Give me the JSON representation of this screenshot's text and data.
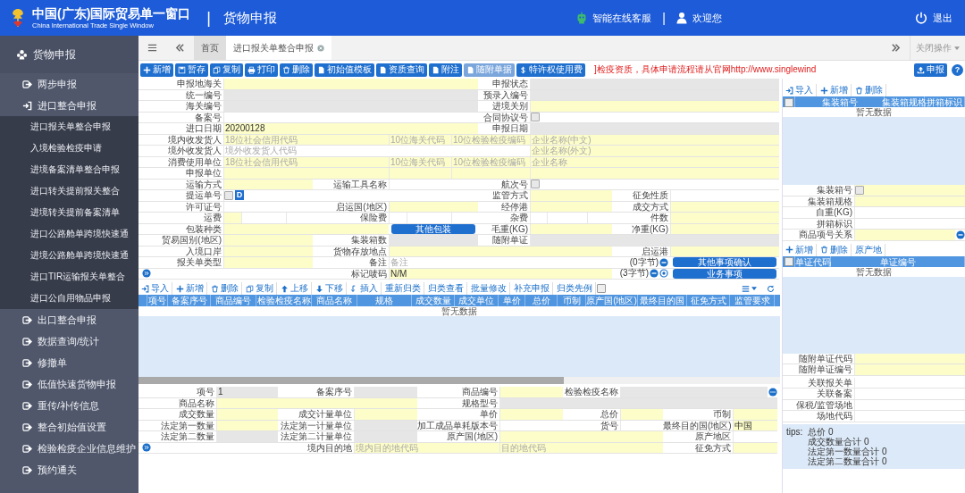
{
  "header": {
    "title": "中国(广东)国际贸易单一窗口",
    "subtitle": "China International Trade Single Window",
    "module": "货物申报",
    "service": "智能在线客服",
    "divider": "|",
    "welcome": "欢迎您",
    "logout": "退出"
  },
  "sidebar": {
    "title": "货物申报",
    "items": [
      {
        "label": "两步申报",
        "expanded": false
      },
      {
        "label": "进口整合申报",
        "expanded": true,
        "children": [
          {
            "label": "进口报关单整合申报"
          },
          {
            "label": "入境检验检疫申请"
          },
          {
            "label": "进境备案清单整合申报"
          },
          {
            "label": "进口转关提前报关整合"
          },
          {
            "label": "进境转关提前备案清单"
          },
          {
            "label": "进口公路舱单跨境快速通"
          },
          {
            "label": "进境公路舱单跨境快速通"
          },
          {
            "label": "进口TIR运输报关单整合"
          },
          {
            "label": "进口公自用物品申报"
          }
        ]
      },
      {
        "label": "出口整合申报",
        "expanded": false
      },
      {
        "label": "数据查询/统计",
        "expanded": false
      },
      {
        "label": "修撤单",
        "expanded": false
      },
      {
        "label": "低值快速货物申报",
        "expanded": false
      },
      {
        "label": "重传/补传信息",
        "expanded": false
      },
      {
        "label": "整合初始值设置",
        "expanded": false
      },
      {
        "label": "检验检疫企业信息维护",
        "expanded": false
      },
      {
        "label": "预约通关",
        "expanded": false
      }
    ]
  },
  "tabs": [
    {
      "label": "首页",
      "selected": false,
      "closable": false
    },
    {
      "label": "进口报关单整合申报",
      "selected": true,
      "closable": true
    }
  ],
  "tab_bar": {
    "close_ops": "关闭操作"
  },
  "toolbar": {
    "buttons": [
      {
        "label": "新增",
        "disabled": false
      },
      {
        "label": "暂存",
        "disabled": false
      },
      {
        "label": "复制",
        "disabled": false
      },
      {
        "label": "打印",
        "disabled": false
      },
      {
        "label": "删除",
        "disabled": false
      },
      {
        "label": "初始值模板",
        "disabled": false
      },
      {
        "label": "资质查询",
        "disabled": false
      },
      {
        "label": "附注",
        "disabled": false
      },
      {
        "label": "随附单据",
        "disabled": true
      },
      {
        "label": "特许权使用费",
        "disabled": false
      }
    ],
    "notice": "]检疫资质，具体申请流程请从官网http://www.singlewind",
    "submit": "申报",
    "help": "?"
  },
  "form": {
    "lines": [
      {
        "groups": [
          {
            "label": "申报地海关",
            "items": [
              {
                "kind": "field",
                "required": true
              }
            ]
          },
          {
            "label": "申报状态",
            "items": [
              {
                "kind": "field",
                "disabled": true
              }
            ]
          }
        ]
      },
      {
        "groups": [
          {
            "label": "统一编号",
            "items": [
              {
                "kind": "field",
                "disabled": true
              }
            ]
          },
          {
            "label": "预录入编号",
            "items": [
              {
                "kind": "field",
                "disabled": true
              }
            ]
          }
        ]
      },
      {
        "groups": [
          {
            "label": "海关编号",
            "items": [
              {
                "kind": "field",
                "disabled": true
              }
            ]
          },
          {
            "label": "进境关别",
            "items": [
              {
                "kind": "field",
                "required": true
              }
            ]
          }
        ]
      },
      {
        "groups": [
          {
            "label": "备案号",
            "items": [
              {
                "kind": "field",
                "required": false
              }
            ]
          },
          {
            "label": "合同协议号",
            "items": [
              {
                "kind": "field",
                "required": false,
                "checked": false
              }
            ]
          }
        ]
      },
      {
        "groups": [
          {
            "label": "进口日期",
            "items": [
              {
                "kind": "field",
                "required": true,
                "value": "20200128"
              }
            ]
          },
          {
            "label": "申报日期",
            "items": [
              {
                "kind": "field",
                "disabled": true
              }
            ]
          }
        ]
      },
      {
        "groups": [
          {
            "label": "境内收发货人",
            "items": [
              {
                "kind": "field",
                "required": true,
                "placeholder": "18位社会信用代码"
              },
              {
                "kind": "field",
                "required": true,
                "placeholder": "10位海关代码"
              },
              {
                "kind": "field",
                "required": true,
                "placeholder": "10位检验检疫编码"
              },
              {
                "kind": "field",
                "required": true,
                "placeholder": "企业名称(中文)"
              }
            ]
          }
        ]
      },
      {
        "groups": [
          {
            "label": "境外收发货人",
            "items": [
              {
                "kind": "field",
                "required": false,
                "placeholder": "境外收发货人代码"
              },
              {
                "kind": "field",
                "required": true,
                "placeholder": "企业名称(外文)"
              }
            ]
          }
        ]
      },
      {
        "groups": [
          {
            "label": "消费使用单位",
            "items": [
              {
                "kind": "field",
                "required": true,
                "placeholder": "18位社会信用代码"
              },
              {
                "kind": "field",
                "required": true,
                "placeholder": "10位海关代码"
              },
              {
                "kind": "field",
                "required": true,
                "placeholder": "10位检验检疫编码"
              },
              {
                "kind": "field",
                "required": true,
                "placeholder": "企业名称"
              }
            ]
          }
        ]
      },
      {
        "groups": [
          {
            "label": "申报单位",
            "items": [
              {
                "kind": "field",
                "required": true
              },
              {
                "kind": "field",
                "required": true
              },
              {
                "kind": "field",
                "required": true
              },
              {
                "kind": "field",
                "required": true
              }
            ]
          }
        ]
      },
      {
        "groups": [
          {
            "label": "运输方式",
            "items": [
              {
                "kind": "field",
                "required": true
              }
            ]
          },
          {
            "label": "运输工具名称",
            "items": [
              {
                "kind": "field",
                "required": false
              }
            ]
          },
          {
            "label": "航次号",
            "items": [
              {
                "kind": "field",
                "required": false,
                "checked": false
              }
            ]
          }
        ]
      },
      {
        "groups": [
          {
            "label": "提运单号",
            "items": [
              {
                "kind": "field",
                "required": false,
                "checked": false,
                "badge": "D"
              }
            ]
          },
          {
            "label": "监管方式",
            "items": [
              {
                "kind": "field",
                "required": true
              }
            ]
          },
          {
            "label": "征免性质",
            "items": [
              {
                "kind": "field",
                "required": false
              }
            ]
          }
        ]
      },
      {
        "groups": [
          {
            "label": "许可证号",
            "items": [
              {
                "kind": "field",
                "required": false
              }
            ]
          },
          {
            "label": "启运国(地区)",
            "items": [
              {
                "kind": "field",
                "required": true
              }
            ]
          },
          {
            "label": "经停港",
            "items": [
              {
                "kind": "field",
                "required": true
              }
            ]
          },
          {
            "label": "成交方式",
            "items": [
              {
                "kind": "field",
                "required": true
              }
            ]
          }
        ]
      },
      {
        "groups": [
          {
            "label": "运费",
            "items": [
              {
                "kind": "field",
                "required": true
              },
              {
                "kind": "field",
                "required": false
              },
              {
                "kind": "field",
                "required": false
              }
            ]
          },
          {
            "label": "保险费",
            "items": [
              {
                "kind": "field",
                "required": false
              },
              {
                "kind": "field",
                "required": false
              },
              {
                "kind": "field",
                "required": false
              }
            ]
          },
          {
            "label": "杂费",
            "items": [
              {
                "kind": "field",
                "required": false
              },
              {
                "kind": "field",
                "required": false
              },
              {
                "kind": "field",
                "required": false
              }
            ]
          },
          {
            "label": "件数",
            "items": [
              {
                "kind": "field",
                "required": true
              }
            ]
          }
        ]
      },
      {
        "groups": [
          {
            "label": "包装种类",
            "items": [
              {
                "kind": "field",
                "required": true
              },
              {
                "kind": "button",
                "text": "其他包装"
              }
            ]
          },
          {
            "label": "毛重(KG)",
            "items": [
              {
                "kind": "field",
                "required": true
              }
            ]
          },
          {
            "label": "净重(KG)",
            "items": [
              {
                "kind": "field",
                "required": true
              }
            ]
          }
        ]
      },
      {
        "groups": [
          {
            "label": "贸易国别(地区)",
            "items": [
              {
                "kind": "field",
                "required": true
              }
            ]
          },
          {
            "label": "集装箱数",
            "items": [
              {
                "kind": "field",
                "disabled": true
              }
            ]
          },
          {
            "label": "随附单证",
            "items": [
              {
                "kind": "field",
                "disabled": true
              }
            ]
          }
        ]
      },
      {
        "groups": [
          {
            "label": "入境口岸",
            "items": [
              {
                "kind": "field",
                "required": true
              }
            ]
          },
          {
            "label": "货物存放地点",
            "items": [
              {
                "kind": "field",
                "required": true
              }
            ]
          },
          {
            "label": "启运港",
            "items": [
              {
                "kind": "field",
                "required": true
              }
            ]
          }
        ]
      },
      {
        "groups": [
          {
            "label": "报关单类型",
            "items": [
              {
                "kind": "field",
                "required": true
              }
            ]
          },
          {
            "label": "备注",
            "items": [
              {
                "kind": "field",
                "required": false,
                "placeholder": "备注"
              },
              {
                "kind": "counter",
                "text": "(0字节)",
                "remove": true
              },
              {
                "kind": "button",
                "text": "其他事项确认"
              }
            ]
          }
        ]
      },
      {
        "groups": [
          {
            "items": [
              {
                "kind": "expand"
              }
            ]
          },
          {
            "label": "标记唛码",
            "items": [
              {
                "kind": "field",
                "required": true,
                "value": "N/M"
              },
              {
                "kind": "counter",
                "text": "(3字节)",
                "remove": true,
                "info": true
              },
              {
                "kind": "button",
                "text": "业务事项"
              }
            ]
          }
        ]
      }
    ]
  },
  "goods": {
    "toolbar": [
      {
        "label": "导入"
      },
      {
        "label": "新增"
      },
      {
        "label": "删除"
      },
      {
        "label": "复制"
      },
      {
        "label": "上移"
      },
      {
        "label": "下移"
      },
      {
        "label": "插入"
      },
      {
        "label": "重新归类"
      },
      {
        "label": "归类查看"
      },
      {
        "label": "批量修改"
      },
      {
        "label": "补充申报"
      },
      {
        "label": "归类先例"
      }
    ],
    "checkbox": {
      "checked": false
    },
    "columns": [
      "项号",
      "备案序号",
      "商品编号",
      "检验检疫名称",
      "商品名称",
      "规格",
      "成交数量",
      "成交单位",
      "单价",
      "总价",
      "币制",
      "原产国(地区)",
      "最终目的国",
      "征免方式",
      "监管要求"
    ],
    "empty": "暂无数据",
    "detail": {
      "lines": [
        {
          "groups": [
            {
              "label": "项号",
              "items": [
                {
                  "kind": "field",
                  "disabled": true,
                  "value": "1"
                }
              ]
            },
            {
              "label": "备案序号",
              "items": [
                {
                  "kind": "field",
                  "disabled": true
                }
              ]
            },
            {
              "label": "商品编号",
              "items": [
                {
                  "kind": "field",
                  "required": true
                }
              ]
            },
            {
              "label": "检验检疫名称",
              "items": [
                {
                  "kind": "field",
                  "disabled": true,
                  "more": true
                }
              ]
            }
          ]
        },
        {
          "groups": [
            {
              "label": "商品名称",
              "items": [
                {
                  "kind": "field",
                  "required": true
                }
              ]
            },
            {
              "label": "规格型号",
              "items": [
                {
                  "kind": "field",
                  "disabled": true
                }
              ]
            }
          ]
        },
        {
          "groups": [
            {
              "label": "成交数量",
              "items": [
                {
                  "kind": "field",
                  "required": true
                }
              ]
            },
            {
              "label": "成交计量单位",
              "items": [
                {
                  "kind": "field",
                  "required": true
                }
              ]
            },
            {
              "label": "单价",
              "items": [
                {
                  "kind": "field",
                  "required": true
                }
              ]
            },
            {
              "label": "总价",
              "items": [
                {
                  "kind": "field",
                  "required": true
                }
              ]
            },
            {
              "label": "币制",
              "items": [
                {
                  "kind": "field",
                  "required": true
                }
              ]
            }
          ]
        },
        {
          "groups": [
            {
              "label": "法定第一数量",
              "items": [
                {
                  "kind": "field",
                  "required": true
                }
              ]
            },
            {
              "label": "法定第一计量单位",
              "items": [
                {
                  "kind": "field",
                  "disabled": true
                }
              ]
            },
            {
              "label": "加工成品单耗版本号",
              "items": [
                {
                  "kind": "field",
                  "required": false
                }
              ]
            },
            {
              "label": "货号",
              "items": [
                {
                  "kind": "field",
                  "required": false
                }
              ]
            },
            {
              "label": "最终目的国(地区)",
              "items": [
                {
                  "kind": "field",
                  "required": true,
                  "value": "中国"
                }
              ]
            }
          ]
        },
        {
          "groups": [
            {
              "label": "法定第二数量",
              "items": [
                {
                  "kind": "field",
                  "disabled": true
                }
              ]
            },
            {
              "label": "法定第二计量单位",
              "items": [
                {
                  "kind": "field",
                  "disabled": true
                }
              ]
            },
            {
              "label": "原产国(地区)",
              "items": [
                {
                  "kind": "field",
                  "required": true
                }
              ]
            },
            {
              "label": "原产地区",
              "items": [
                {
                  "kind": "field",
                  "required": false
                }
              ]
            }
          ]
        },
        {
          "groups": [
            {
              "items": [
                {
                  "kind": "expand"
                }
              ]
            },
            {
              "label": "境内目的地",
              "items": [
                {
                  "kind": "field",
                  "required": true,
                  "placeholder": "境内目的地代码"
                },
                {
                  "kind": "field",
                  "required": true,
                  "placeholder": "目的地代码"
                }
              ]
            },
            {
              "label": "征免方式",
              "items": [
                {
                  "kind": "field",
                  "required": true
                }
              ]
            }
          ]
        }
      ]
    }
  },
  "containers": {
    "toolbar": [
      {
        "label": "导入"
      },
      {
        "label": "新增"
      },
      {
        "label": "删除"
      }
    ],
    "checked": false,
    "columns": [
      "集装箱号",
      "集装箱规格",
      "拼箱标识"
    ],
    "empty": "暂无数据",
    "rows": [
      {
        "label": "集装箱号",
        "field": {
          "kind": "field",
          "required": true,
          "checked": false
        }
      },
      {
        "label": "集装箱规格",
        "field": {
          "kind": "field",
          "required": true
        }
      },
      {
        "label": "自重(KG)",
        "field": {
          "kind": "field",
          "required": false
        }
      },
      {
        "label": "拼箱标识",
        "field": {
          "kind": "field",
          "required": false
        }
      },
      {
        "label": "商品项号关系",
        "field": {
          "kind": "field",
          "required": true,
          "remove": true
        }
      }
    ]
  },
  "documents": {
    "toolbar": [
      {
        "label": "新增"
      },
      {
        "label": "删除"
      },
      {
        "label": "原产地"
      }
    ],
    "checked": false,
    "columns": [
      "单证代码",
      "单证编号"
    ],
    "empty": "暂无数据",
    "rows": [
      {
        "label": "随附单证代码",
        "field": {
          "kind": "field",
          "required": true
        }
      },
      {
        "label": "随附单证编号",
        "field": {
          "kind": "field",
          "required": true
        }
      }
    ]
  },
  "related": {
    "rows": [
      {
        "label": "关联报关单",
        "field": {
          "kind": "field",
          "required": false
        }
      },
      {
        "label": "关联备案",
        "field": {
          "kind": "field",
          "required": false
        }
      },
      {
        "label": "保税/监管场地",
        "field": {
          "kind": "field",
          "required": false
        }
      },
      {
        "label": "场地代码",
        "field": {
          "kind": "field",
          "required": false
        }
      }
    ]
  },
  "tips": {
    "label": "tips:",
    "lines": [
      "总价 0",
      "成交数量合计 0",
      "法定第一数量合计 0",
      "法定第二数量合计 0"
    ]
  }
}
